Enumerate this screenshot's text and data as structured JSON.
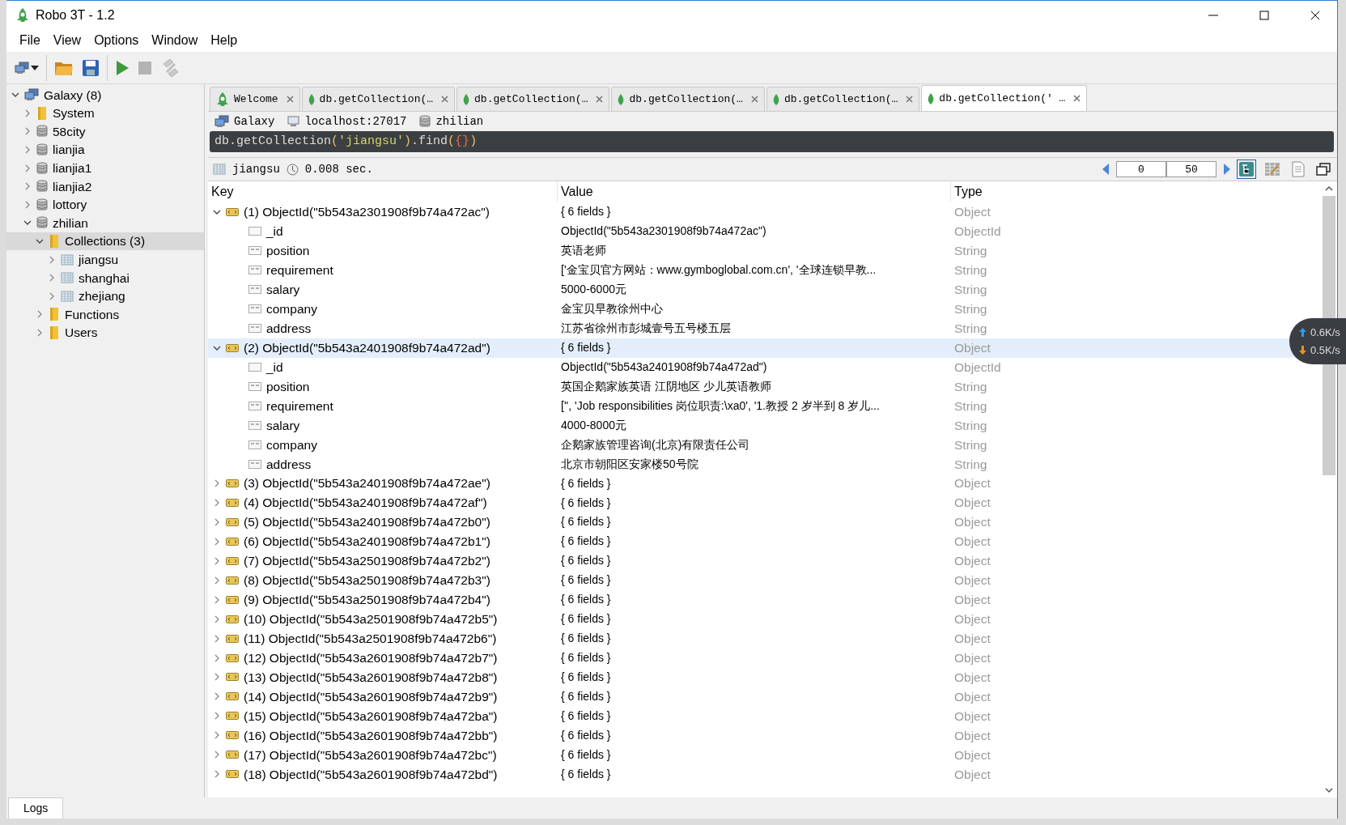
{
  "window": {
    "title": "Robo 3T - 1.2"
  },
  "menu": [
    "File",
    "View",
    "Options",
    "Window",
    "Help"
  ],
  "toolbar": [
    {
      "kind": "connect",
      "disabled": false
    },
    {
      "kind": "open",
      "disabled": false
    },
    {
      "kind": "save",
      "disabled": false
    },
    {
      "kind": "run",
      "disabled": false
    },
    {
      "kind": "stop",
      "disabled": true
    },
    {
      "kind": "format",
      "disabled": true
    }
  ],
  "sidebar": {
    "tree": [
      {
        "label": "Galaxy (8)",
        "kind": "server",
        "expanded": true,
        "selected": false,
        "children": [
          {
            "label": "System",
            "kind": "folder",
            "expanded": false,
            "selected": false
          },
          {
            "label": "58city",
            "kind": "database",
            "expanded": false,
            "selected": false
          },
          {
            "label": "lianjia",
            "kind": "database",
            "expanded": false,
            "selected": false
          },
          {
            "label": "lianjia1",
            "kind": "database",
            "expanded": false,
            "selected": false
          },
          {
            "label": "lianjia2",
            "kind": "database",
            "expanded": false,
            "selected": false
          },
          {
            "label": "lottory",
            "kind": "database",
            "expanded": false,
            "selected": false
          },
          {
            "label": "zhilian",
            "kind": "database",
            "expanded": true,
            "selected": false,
            "children": [
              {
                "label": "Collections (3)",
                "kind": "folder",
                "expanded": true,
                "selected": true,
                "children": [
                  {
                    "label": "jiangsu",
                    "kind": "collection",
                    "expanded": false,
                    "selected": false
                  },
                  {
                    "label": "shanghai",
                    "kind": "collection",
                    "expanded": false,
                    "selected": false
                  },
                  {
                    "label": "zhejiang",
                    "kind": "collection",
                    "expanded": false,
                    "selected": false
                  }
                ]
              },
              {
                "label": "Functions",
                "kind": "folder",
                "expanded": false,
                "selected": false
              },
              {
                "label": "Users",
                "kind": "folder",
                "expanded": false,
                "selected": false
              }
            ]
          }
        ]
      }
    ]
  },
  "tabs": [
    {
      "label": "Welcome",
      "kind": "welcome",
      "selected": false
    },
    {
      "label": "db.getCollection(…",
      "kind": "query",
      "selected": false
    },
    {
      "label": "db.getCollection(…",
      "kind": "query",
      "selected": false
    },
    {
      "label": "db.getCollection(…",
      "kind": "query",
      "selected": false
    },
    {
      "label": "db.getCollection(…",
      "kind": "query",
      "selected": false
    },
    {
      "label": "db.getCollection(' …",
      "kind": "query",
      "selected": true
    }
  ],
  "breadcrumb": [
    {
      "label": "Galaxy",
      "kind": "server"
    },
    {
      "label": "localhost:27017",
      "kind": "host"
    },
    {
      "label": "zhilian",
      "kind": "database"
    }
  ],
  "query": [
    {
      "text": "db.getCollection",
      "kind": "plain"
    },
    {
      "text": "(",
      "kind": "paren"
    },
    {
      "text": "'jiangsu'",
      "kind": "string"
    },
    {
      "text": ")",
      "kind": "paren"
    },
    {
      "text": ".find",
      "kind": "plain"
    },
    {
      "text": "(",
      "kind": "paren"
    },
    {
      "text": "{}",
      "kind": "brace"
    },
    {
      "text": ")",
      "kind": "paren"
    }
  ],
  "results": {
    "collection": "jiangsu",
    "time": "0.008 sec.",
    "skip": "0",
    "limit": "50",
    "views": [
      {
        "kind": "tree",
        "selected": true
      },
      {
        "kind": "table",
        "selected": false
      },
      {
        "kind": "text",
        "selected": false
      }
    ],
    "columns": [
      "Key",
      "Value",
      "Type"
    ],
    "rows": [
      {
        "key": "(1) ObjectId(\"5b543a2301908f9b74a472ac\")",
        "value": "{ 6 fields }",
        "type": "Object",
        "expanded": true,
        "selected": false,
        "children": [
          {
            "key": "_id",
            "value": "ObjectId(\"5b543a2301908f9b74a472ac\")",
            "type": "ObjectId"
          },
          {
            "key": "position",
            "value": "英语老师",
            "type": "String"
          },
          {
            "key": "requirement",
            "value": "['金宝贝官方网站：www.gymboglobal.com.cn', '全球连锁早教...",
            "type": "String"
          },
          {
            "key": "salary",
            "value": "5000-6000元",
            "type": "String"
          },
          {
            "key": "company",
            "value": "金宝贝早教徐州中心",
            "type": "String"
          },
          {
            "key": "address",
            "value": "江苏省徐州市彭城壹号五号楼五层",
            "type": "String"
          }
        ]
      },
      {
        "key": "(2) ObjectId(\"5b543a2401908f9b74a472ad\")",
        "value": "{ 6 fields }",
        "type": "Object",
        "expanded": true,
        "selected": true,
        "children": [
          {
            "key": "_id",
            "value": "ObjectId(\"5b543a2401908f9b74a472ad\")",
            "type": "ObjectId"
          },
          {
            "key": "position",
            "value": "英国企鹅家族英语 江阴地区 少儿英语教师",
            "type": "String"
          },
          {
            "key": "requirement",
            "value": "['', 'Job responsibilities 岗位职责:\\xa0', '1.教授 2 岁半到 8 岁儿...",
            "type": "String"
          },
          {
            "key": "salary",
            "value": "4000-8000元",
            "type": "String"
          },
          {
            "key": "company",
            "value": "企鹅家族管理咨询(北京)有限责任公司",
            "type": "String"
          },
          {
            "key": "address",
            "value": "北京市朝阳区安家楼50号院",
            "type": "String"
          }
        ]
      },
      {
        "key": "(3) ObjectId(\"5b543a2401908f9b74a472ae\")",
        "value": "{ 6 fields }",
        "type": "Object",
        "expanded": false,
        "selected": false
      },
      {
        "key": "(4) ObjectId(\"5b543a2401908f9b74a472af\")",
        "value": "{ 6 fields }",
        "type": "Object",
        "expanded": false,
        "selected": false
      },
      {
        "key": "(5) ObjectId(\"5b543a2401908f9b74a472b0\")",
        "value": "{ 6 fields }",
        "type": "Object",
        "expanded": false,
        "selected": false
      },
      {
        "key": "(6) ObjectId(\"5b543a2401908f9b74a472b1\")",
        "value": "{ 6 fields }",
        "type": "Object",
        "expanded": false,
        "selected": false
      },
      {
        "key": "(7) ObjectId(\"5b543a2501908f9b74a472b2\")",
        "value": "{ 6 fields }",
        "type": "Object",
        "expanded": false,
        "selected": false
      },
      {
        "key": "(8) ObjectId(\"5b543a2501908f9b74a472b3\")",
        "value": "{ 6 fields }",
        "type": "Object",
        "expanded": false,
        "selected": false
      },
      {
        "key": "(9) ObjectId(\"5b543a2501908f9b74a472b4\")",
        "value": "{ 6 fields }",
        "type": "Object",
        "expanded": false,
        "selected": false
      },
      {
        "key": "(10) ObjectId(\"5b543a2501908f9b74a472b5\")",
        "value": "{ 6 fields }",
        "type": "Object",
        "expanded": false,
        "selected": false
      },
      {
        "key": "(11) ObjectId(\"5b543a2501908f9b74a472b6\")",
        "value": "{ 6 fields }",
        "type": "Object",
        "expanded": false,
        "selected": false
      },
      {
        "key": "(12) ObjectId(\"5b543a2601908f9b74a472b7\")",
        "value": "{ 6 fields }",
        "type": "Object",
        "expanded": false,
        "selected": false
      },
      {
        "key": "(13) ObjectId(\"5b543a2601908f9b74a472b8\")",
        "value": "{ 6 fields }",
        "type": "Object",
        "expanded": false,
        "selected": false
      },
      {
        "key": "(14) ObjectId(\"5b543a2601908f9b74a472b9\")",
        "value": "{ 6 fields }",
        "type": "Object",
        "expanded": false,
        "selected": false
      },
      {
        "key": "(15) ObjectId(\"5b543a2601908f9b74a472ba\")",
        "value": "{ 6 fields }",
        "type": "Object",
        "expanded": false,
        "selected": false
      },
      {
        "key": "(16) ObjectId(\"5b543a2601908f9b74a472bb\")",
        "value": "{ 6 fields }",
        "type": "Object",
        "expanded": false,
        "selected": false
      },
      {
        "key": "(17) ObjectId(\"5b543a2601908f9b74a472bc\")",
        "value": "{ 6 fields }",
        "type": "Object",
        "expanded": false,
        "selected": false
      },
      {
        "key": "(18) ObjectId(\"5b543a2601908f9b74a472bd\")",
        "value": "{ 6 fields }",
        "type": "Object",
        "expanded": false,
        "selected": false
      }
    ]
  },
  "bottom_tabs": [
    "Logs"
  ],
  "net_speed": {
    "up": "0.6K/s",
    "down": "0.5K/s"
  }
}
